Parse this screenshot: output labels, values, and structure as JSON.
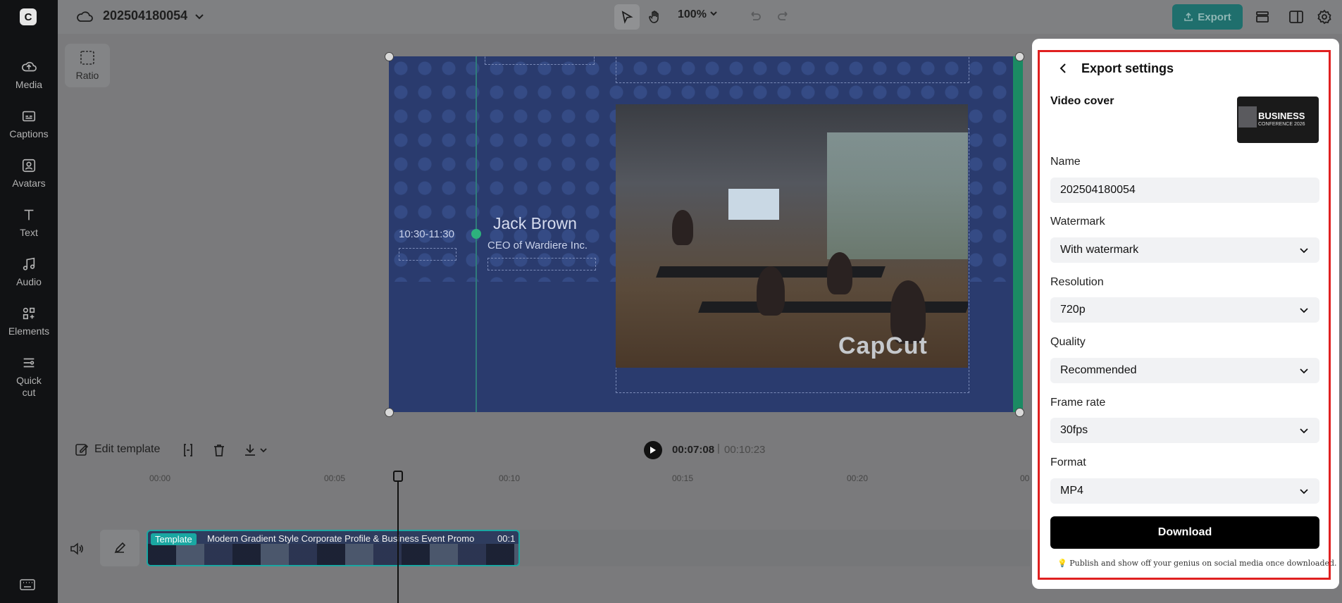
{
  "project": {
    "title": "202504180054",
    "zoom": "100%"
  },
  "toolbar": {
    "export_label": "Export"
  },
  "sidebar": {
    "items": [
      {
        "label": "Media"
      },
      {
        "label": "Captions"
      },
      {
        "label": "Avatars"
      },
      {
        "label": "Text"
      },
      {
        "label": "Audio"
      },
      {
        "label": "Elements"
      },
      {
        "label": "Quick cut"
      }
    ]
  },
  "canvas": {
    "ratio_label": "Ratio",
    "time_label": "10:30-11:30",
    "speaker_name": "Jack Brown",
    "speaker_role": "CEO of Wardiere Inc.",
    "watermark": "CapCut"
  },
  "editor": {
    "edit_template_label": "Edit template",
    "current_time": "00:07:08",
    "separator": "|",
    "total_time": "00:10:23"
  },
  "timeline": {
    "ticks": [
      "00:00",
      "00:05",
      "00:10",
      "00:15",
      "00:20",
      "00"
    ],
    "clip_tag": "Template",
    "clip_name": "Modern Gradient Style Corporate Profile & Business Event Promo",
    "clip_duration": "00:1"
  },
  "export_panel": {
    "title": "Export settings",
    "video_cover_label": "Video cover",
    "cover_title": "BUSINESS",
    "cover_subtitle": "CONFERENCE 2026",
    "name_label": "Name",
    "name_value": "202504180054",
    "watermark_label": "Watermark",
    "watermark_value": "With watermark",
    "resolution_label": "Resolution",
    "resolution_value": "720p",
    "quality_label": "Quality",
    "quality_value": "Recommended",
    "frame_rate_label": "Frame rate",
    "frame_rate_value": "30fps",
    "format_label": "Format",
    "format_value": "MP4",
    "download_label": "Download",
    "hint_icon": "💡",
    "hint": "Publish and show off your genius on social media once downloaded."
  },
  "colors": {
    "accent": "#1aa7a2",
    "highlight_frame": "#e02020",
    "canvas_bg": "#2a3b6e"
  }
}
